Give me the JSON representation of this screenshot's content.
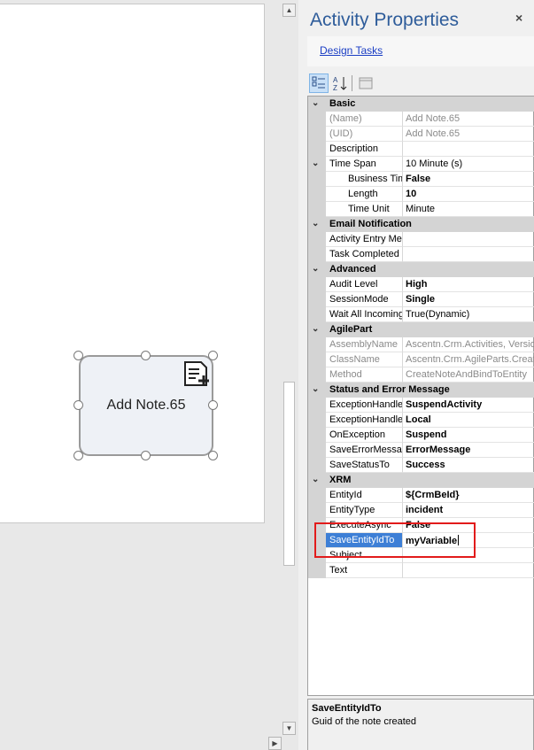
{
  "canvas": {
    "shape": {
      "label": "Add Note.65",
      "icon": "note-add-icon"
    }
  },
  "panel": {
    "title": "Activity Properties",
    "close_glyph": "×",
    "design_tasks": "Design Tasks",
    "toolbar": {
      "categorized": "categorized-view-icon",
      "alphabetical": "alphabetical-sort-icon",
      "pages": "property-pages-icon"
    }
  },
  "grid": {
    "basic": {
      "label": "Basic",
      "name": {
        "name": "(Name)",
        "value": "Add Note.65"
      },
      "uid": {
        "name": "(UID)",
        "value": "Add Note.65"
      },
      "description": {
        "name": "Description",
        "value": ""
      },
      "time_span": {
        "name": "Time Span",
        "value": "10 Minute (s)"
      },
      "business": {
        "name": "Business Time",
        "value": "False"
      },
      "length": {
        "name": "Length",
        "value": "10"
      },
      "time_unit": {
        "name": "Time Unit",
        "value": "Minute"
      }
    },
    "email": {
      "label": "Email Notification",
      "entry": {
        "name": "Activity Entry Message",
        "value": ""
      },
      "completed": {
        "name": "Task Completed",
        "value": ""
      }
    },
    "advanced": {
      "label": "Advanced",
      "audit": {
        "name": "Audit Level",
        "value": "High"
      },
      "session": {
        "name": "SessionMode",
        "value": "Single"
      },
      "wait": {
        "name": "Wait All Incoming",
        "value": "True(Dynamic)"
      }
    },
    "agilepart": {
      "label": "AgilePart",
      "assembly": {
        "name": "AssemblyName",
        "value": "Ascentn.Crm.Activities, Version"
      },
      "classname": {
        "name": "ClassName",
        "value": "Ascentn.Crm.AgileParts.CreateNote"
      },
      "method": {
        "name": "Method",
        "value": "CreateNoteAndBindToEntity"
      }
    },
    "status": {
      "label": "Status and Error Message",
      "handler1": {
        "name": "ExceptionHandler",
        "value": "SuspendActivity"
      },
      "handler2": {
        "name": "ExceptionHandler",
        "value": "Local"
      },
      "onexc": {
        "name": "OnException",
        "value": "Suspend"
      },
      "saveerr": {
        "name": "SaveErrorMessage",
        "value": "ErrorMessage"
      },
      "savestat": {
        "name": "SaveStatusTo",
        "value": "Success"
      }
    },
    "xrm": {
      "label": "XRM",
      "entityid": {
        "name": "EntityId",
        "value": "${CrmBeId}"
      },
      "entitytype": {
        "name": "EntityType",
        "value": "incident"
      },
      "execasync": {
        "name": "ExecuteAsync",
        "value": "False"
      },
      "saveid": {
        "name": "SaveEntityIdTo",
        "value": "myVariable"
      },
      "subject": {
        "name": "Subject",
        "value": ""
      },
      "text": {
        "name": "Text",
        "value": ""
      }
    }
  },
  "description": {
    "title": "SaveEntityIdTo",
    "text": "Guid of the note created"
  },
  "colors": {
    "accent": "#2e5c9a",
    "selection": "#3d7fd6",
    "highlight": "#e21b1b"
  }
}
